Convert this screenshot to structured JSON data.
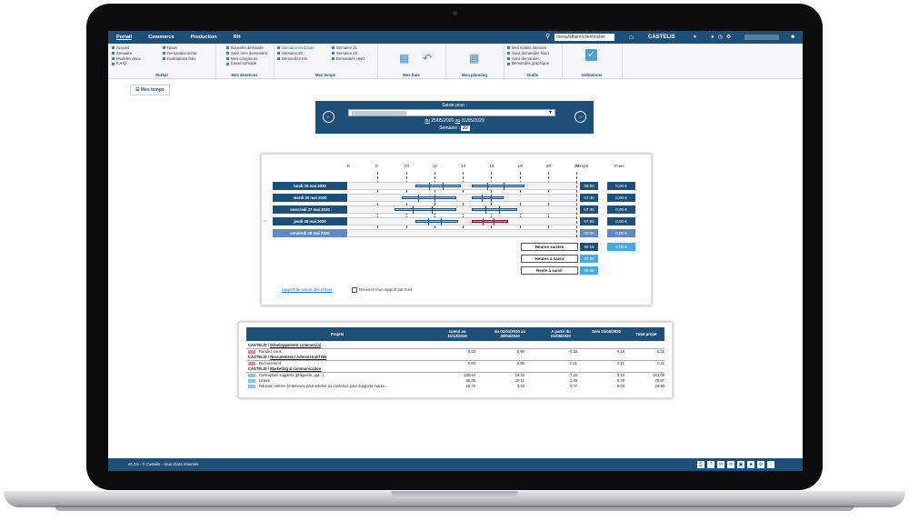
{
  "topnav": {
    "items": [
      "Portail",
      "Commerce",
      "Production",
      "RH"
    ],
    "active": "Portail"
  },
  "search": {
    "placeholder": "menu/affaire/client/ticket"
  },
  "company": {
    "name": "CASTELIS"
  },
  "ribbon": {
    "portail": {
      "items": [
        "Accueil",
        "Annuaire",
        "Modeles docs",
        "F.A.Q."
      ],
      "items2": [
        "News",
        "Demandes achat",
        "Evaluations frais"
      ],
      "name": "Portail"
    },
    "absences": {
      "items": [
        "Nouvelle demande",
        "Suivi mes demandes",
        "Mes compteurs",
        "travail nomade"
      ],
      "name": "Mes absences"
    },
    "temps": {
      "items": [
        "Semaine en Cours",
        "Semaine 20",
        "Demandes HS"
      ],
      "items2": [
        "Semaine 21",
        "Semaine 19",
        "Demandes HNO"
      ],
      "name": "Mes temps"
    },
    "frais": {
      "name": "Mes frais"
    },
    "planning": {
      "name": "Mon planning"
    },
    "outils": {
      "items": [
        "Mes tickets internes",
        "Suivi demandes histo",
        "Suivi demandes",
        "Demandes graphique"
      ],
      "name": "Outils"
    },
    "validations": {
      "name": "Validations"
    }
  },
  "mes_temps_button": "Mes temps",
  "saisie": {
    "title": "Saisie pour :",
    "du": "du",
    "date_from": "25/05/2020",
    "au": "au",
    "date_to": "31/05/2020",
    "week_label": "Semaine :",
    "week_num": "22"
  },
  "planning": {
    "hours": [
      "6",
      "8",
      "10",
      "12",
      "14",
      "16",
      "18",
      "20",
      "22"
    ],
    "col_temps": "Temps",
    "col_frais": "Frais",
    "days": [
      {
        "label": "lundi 25 mai 2020",
        "temps": "08:00",
        "frais": "0,00 €"
      },
      {
        "label": "mardi 26 mai 2020",
        "temps": "07:30",
        "frais": "0,00 €"
      },
      {
        "label": "mercredi 27 mai 2020",
        "temps": "07:45",
        "frais": "0,00 €"
      },
      {
        "label": "jeudi 28 mai 2020",
        "temps": "07:00",
        "frais": "0,00 €"
      },
      {
        "label": "vendredi 29 mai 2020",
        "temps": "00:00",
        "frais": "0,00 €"
      }
    ],
    "heures_saisies_label": "Heures saisies",
    "heures_saisies": "30:15",
    "total_frais": "0,00 €",
    "heures_a_saisir_label": "Heures à saisir",
    "heures_a_saisir": "37:00",
    "reste_label": "Reste à saisir",
    "reste": "06:45",
    "rapport_link": "rapport de saisie des temps",
    "mail_label": "Recevoir mon rapport par mail"
  },
  "projets": {
    "headers": [
      "Projets",
      "cumul au 31/12/2019",
      "du 01/01/2020 au 30/04/2020",
      "A partir du 01/05/2020",
      "Sem 01/05/2020",
      "Total projet"
    ],
    "sections": [
      {
        "client": "CASTELIS",
        "group": "Développement commercial",
        "rows": [
          {
            "name": "Rendez-vous",
            "color": "#d98bab",
            "v": [
              "0,03",
              "0,00",
              "0,18",
              "0,18",
              "0,21"
            ]
          }
        ]
      },
      {
        "client": "CASTELIS",
        "group": "Recrutement / Administratif RH",
        "rows": [
          {
            "name": "Recrutement",
            "color": "#d98bab",
            "v": [
              "0,00",
              "0,00",
              "0,11",
              "0,11",
              "0,11"
            ]
          }
        ]
      },
      {
        "client": "CASTELIS",
        "group": "Marketing & communication",
        "rows": [
          {
            "name": "Conception supports (plaquette, ppt...)",
            "color": "#8cc3e8",
            "v": [
              "135,64",
              "19,32",
              "7,22",
              "3,10",
              "161,09"
            ]
          },
          {
            "name": "Divers",
            "color": "#8cc3e8",
            "v": [
              "68,29",
              "19,11",
              "1,36",
              "0,79",
              "78,87"
            ]
          },
          {
            "name": "Réunion interne (entrevues pour articles ou contenus pour supports marke...",
            "color": "#8cc3e8",
            "v": [
              "26,70",
              "3,33",
              "0,77",
              "0,00",
              "30,80"
            ]
          }
        ]
      }
    ]
  },
  "footer": {
    "text": "v3.3.5 - © Castelis – tous droits réservés"
  },
  "icons": {
    "search": "search-icon",
    "home": "home-icon",
    "bell": "bell-icon",
    "user": "user-icon"
  }
}
